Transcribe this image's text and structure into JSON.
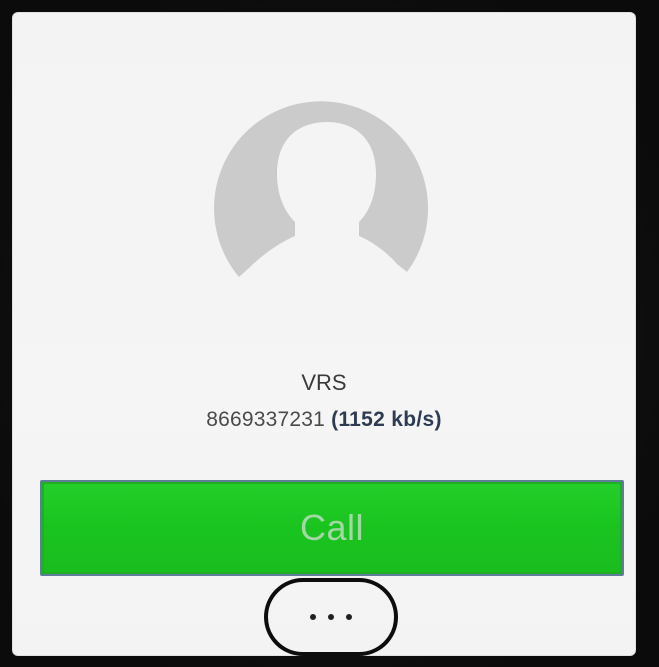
{
  "caller": {
    "avatar_icon": "person-silhouette-icon",
    "name": "VRS",
    "number": "8669337231",
    "rate": "(1152 kb/s)"
  },
  "actions": {
    "call_label": "Call",
    "more_icon": "ellipsis-icon"
  },
  "colors": {
    "screen_bg": "#f4f4f4",
    "call_green": "#1fc924",
    "call_text": "#a3d7a6",
    "avatar_gray": "#c9c9c9",
    "rate_text": "#2d3c52"
  }
}
